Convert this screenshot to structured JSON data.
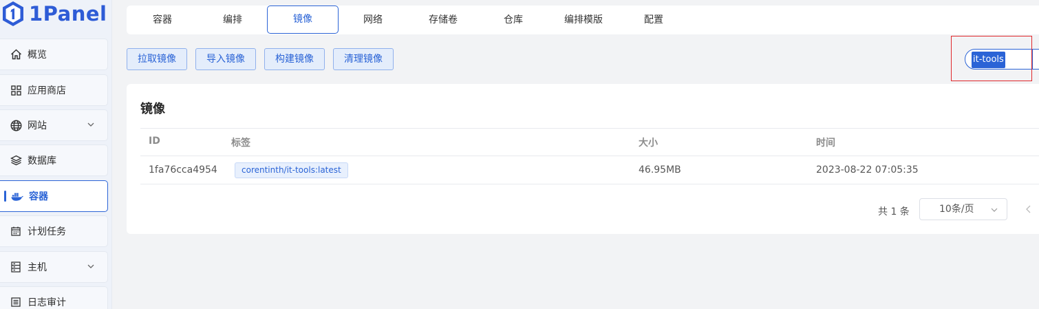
{
  "app": {
    "name": "1Panel"
  },
  "sidebar": {
    "items": [
      {
        "label": "概览",
        "icon": "home-icon",
        "has_chevron": false,
        "active": false
      },
      {
        "label": "应用商店",
        "icon": "apps-grid-icon",
        "has_chevron": false,
        "active": false
      },
      {
        "label": "网站",
        "icon": "globe-icon",
        "has_chevron": true,
        "active": false
      },
      {
        "label": "数据库",
        "icon": "layers-icon",
        "has_chevron": false,
        "active": false
      },
      {
        "label": "容器",
        "icon": "docker-icon",
        "has_chevron": false,
        "active": true
      },
      {
        "label": "计划任务",
        "icon": "calendar-icon",
        "has_chevron": false,
        "active": false
      },
      {
        "label": "主机",
        "icon": "server-icon",
        "has_chevron": true,
        "active": false
      },
      {
        "label": "日志审计",
        "icon": "log-icon",
        "has_chevron": false,
        "active": false
      }
    ]
  },
  "tabs": [
    {
      "label": "容器",
      "active": false
    },
    {
      "label": "编排",
      "active": false
    },
    {
      "label": "镜像",
      "active": true
    },
    {
      "label": "网络",
      "active": false
    },
    {
      "label": "存储卷",
      "active": false
    },
    {
      "label": "仓库",
      "active": false
    },
    {
      "label": "编排模版",
      "active": false
    },
    {
      "label": "配置",
      "active": false
    }
  ],
  "actions": {
    "pull": "拉取镜像",
    "import": "导入镜像",
    "build": "构建镜像",
    "prune": "清理镜像"
  },
  "search": {
    "value": "it-tools"
  },
  "images": {
    "title": "镜像",
    "columns": {
      "id": "ID",
      "tag": "标签",
      "size": "大小",
      "time": "时间"
    },
    "rows": [
      {
        "id": "1fa76cca4954",
        "tag": "corentinth/it-tools:latest",
        "size": "46.95MB",
        "time": "2023-08-22 07:05:35"
      }
    ],
    "total": "共 1 条",
    "page_size": "10条/页"
  },
  "colors": {
    "accent": "#2a63d6",
    "highlight_frame": "#e0262a",
    "background": "#f2f3f5"
  }
}
